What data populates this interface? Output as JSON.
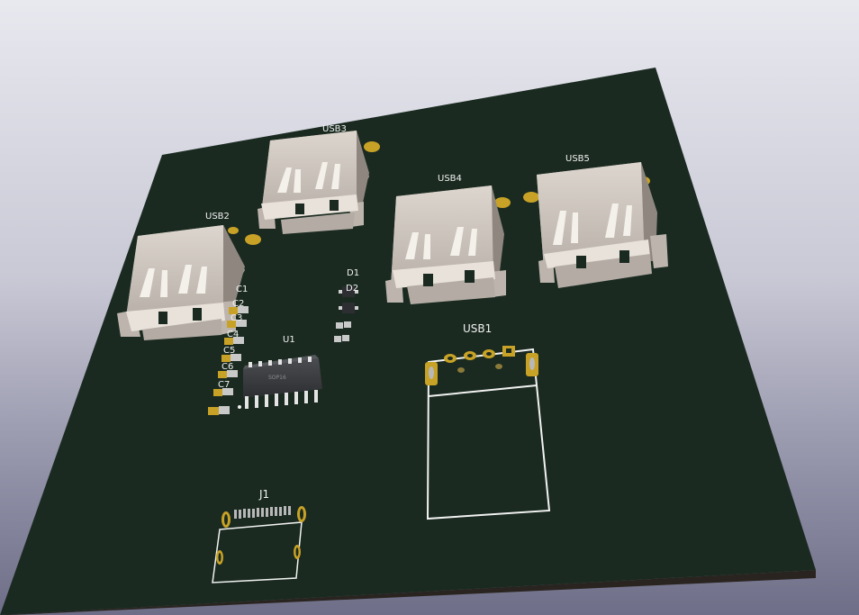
{
  "board": {
    "colors": {
      "solder_mask": "#1a2a20",
      "silkscreen": "#f2f2f2",
      "copper_pad": "#c8a226",
      "usb_shell": "#cfc8c0",
      "ic_body": "#3a3c40"
    }
  },
  "references": {
    "usb1": "USB1",
    "usb2": "USB2",
    "usb3": "USB3",
    "usb4": "USB4",
    "usb5": "USB5",
    "u1": "U1",
    "j1": "J1",
    "d1": "D1",
    "d2": "D2",
    "c1": "C1",
    "c2": "C2",
    "c3": "C3",
    "c4": "C4",
    "c5": "C5",
    "c6": "C6",
    "c7": "C7",
    "ic_marking": "SOP16"
  }
}
